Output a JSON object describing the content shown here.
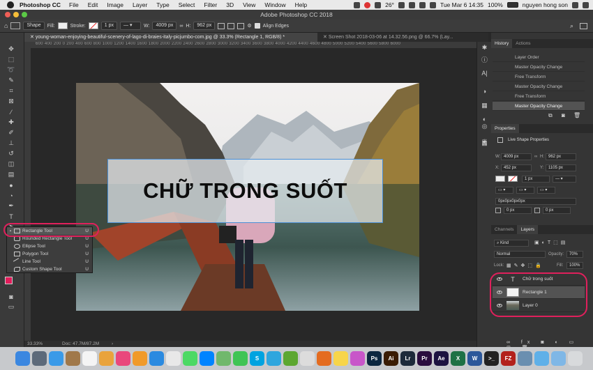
{
  "menubar": {
    "app_name": "Photoshop CC",
    "items": [
      "File",
      "Edit",
      "Image",
      "Layer",
      "Type",
      "Select",
      "Filter",
      "3D",
      "View",
      "Window",
      "Help"
    ],
    "temperature": "26°",
    "clock": "Tue Mar 6  14:35",
    "battery": "100%",
    "user": "nguyen hong son"
  },
  "window": {
    "title": "Adobe Photoshop CC 2018"
  },
  "options_bar": {
    "mode": "Shape",
    "fill_label": "Fill:",
    "stroke_label": "Stroke:",
    "stroke_width": "1 px",
    "w_label": "W:",
    "w_value": "4009 px",
    "h_label": "H:",
    "h_value": "962 px",
    "align_edges": "Align Edges"
  },
  "tabs": [
    {
      "label": "young-woman-enjoying-beautiful-scenery-of-lago-di-braies-italy-picjumbo-com.jpg @ 33.3% (Rectangle 1, RGB/8) *"
    },
    {
      "label": "Screen Shot 2018-03-06 at 14.32.56.png @ 66.7% (Lay..."
    }
  ],
  "ruler_top": "600  400  200  0  200  400  600  800  1000  1200  1400  1600  1800  2000  2200  2400  2600  2800  3000  3200  3400  3600  3800  4000  4200  4400  4600  4800  5000  5200  5400  5600  5800  6000",
  "canvas": {
    "text": "CHỮ TRONG SUỐT"
  },
  "flyout": {
    "items": [
      {
        "label": "Rectangle Tool",
        "key": "U"
      },
      {
        "label": "Rounded Rectangle Tool",
        "key": "U"
      },
      {
        "label": "Ellipse Tool",
        "key": "U"
      },
      {
        "label": "Polygon Tool",
        "key": "U"
      },
      {
        "label": "Line Tool",
        "key": "U"
      },
      {
        "label": "Custom Shape Tool",
        "key": "U"
      }
    ]
  },
  "status": {
    "zoom": "33.33%",
    "doc": "Doc: 47.7M/87.2M"
  },
  "history": {
    "tabs": [
      "History",
      "Actions"
    ],
    "items": [
      "Layer Order",
      "Master Opacity Change",
      "Free Transform",
      "Master Opacity Change",
      "Free Transform",
      "Master Opacity Change"
    ]
  },
  "properties": {
    "title": "Properties",
    "subtitle": "Live Shape Properties",
    "w_label": "W:",
    "w": "4009 px",
    "h_label": "H:",
    "h": "962 px",
    "x_label": "X:",
    "x": "452 px",
    "y_label": "Y:",
    "y": "1105 px",
    "stroke": "1 px",
    "radius": "0px0px0px0px",
    "corner1": "0 px",
    "corner2": "0 px"
  },
  "layers_panel": {
    "tabs": [
      "Channels",
      "Layers"
    ],
    "kind": "Kind",
    "blend": "Normal",
    "opacity_label": "Opacity:",
    "opacity": "70%",
    "lock_label": "Lock:",
    "fill_label": "Fill:",
    "fill": "100%",
    "layers": [
      {
        "name": "Chữ trong suốt",
        "type": "text"
      },
      {
        "name": "Rectangle 1",
        "type": "shape"
      },
      {
        "name": "Layer 0",
        "type": "image"
      }
    ]
  },
  "dock": [
    {
      "name": "finder",
      "label": "",
      "color": "#3b87e0"
    },
    {
      "name": "launchpad",
      "label": "",
      "color": "#5d6a7a"
    },
    {
      "name": "safari",
      "label": "",
      "color": "#3a9ae8"
    },
    {
      "name": "contacts",
      "label": "",
      "color": "#a0784a"
    },
    {
      "name": "calendar",
      "label": "",
      "color": "#f4f4f4"
    },
    {
      "name": "photos",
      "label": "",
      "color": "#e9a33c"
    },
    {
      "name": "itunes",
      "label": "",
      "color": "#e9477c"
    },
    {
      "name": "ibooks",
      "label": "",
      "color": "#f09a2a"
    },
    {
      "name": "appstore",
      "label": "",
      "color": "#2a8ae0"
    },
    {
      "name": "chrome-app",
      "label": "",
      "color": "#e8e8e8"
    },
    {
      "name": "messages",
      "label": "",
      "color": "#4cd964"
    },
    {
      "name": "messenger",
      "label": "",
      "color": "#0084ff"
    },
    {
      "name": "maps",
      "label": "",
      "color": "#70b86c"
    },
    {
      "name": "facetime",
      "label": "",
      "color": "#3fc455"
    },
    {
      "name": "skype",
      "label": "S",
      "color": "#00a3e0"
    },
    {
      "name": "telegram",
      "label": "",
      "color": "#2ea6de"
    },
    {
      "name": "evernote",
      "label": "",
      "color": "#5ca731"
    },
    {
      "name": "chrome",
      "label": "",
      "color": "#dcdcdc"
    },
    {
      "name": "firefox",
      "label": "",
      "color": "#e46c20"
    },
    {
      "name": "notes",
      "label": "",
      "color": "#f7d54a"
    },
    {
      "name": "flower",
      "label": "",
      "color": "#c856c9"
    },
    {
      "name": "photoshop",
      "label": "Ps",
      "color": "#0c2740"
    },
    {
      "name": "illustrator",
      "label": "Ai",
      "color": "#3a1c04"
    },
    {
      "name": "lightroom",
      "label": "Lr",
      "color": "#1d2a3a"
    },
    {
      "name": "premiere",
      "label": "Pr",
      "color": "#2b0d3f"
    },
    {
      "name": "aftereffects",
      "label": "Ae",
      "color": "#1d1340"
    },
    {
      "name": "excel",
      "label": "X",
      "color": "#1e7145"
    },
    {
      "name": "word",
      "label": "W",
      "color": "#2b579a"
    },
    {
      "name": "terminal",
      "label": ">_",
      "color": "#222"
    },
    {
      "name": "filezilla",
      "label": "FZ",
      "color": "#b3211c"
    },
    {
      "name": "preview",
      "label": "",
      "color": "#6a8fb0"
    },
    {
      "name": "folder",
      "label": "",
      "color": "#5fb0e8"
    },
    {
      "name": "downloads",
      "label": "",
      "color": "#7fb7e6"
    },
    {
      "name": "trash",
      "label": "",
      "color": "#d8dadc"
    }
  ],
  "colors": {
    "annotation": "#e0205c",
    "selection": "#4a8fd6"
  }
}
